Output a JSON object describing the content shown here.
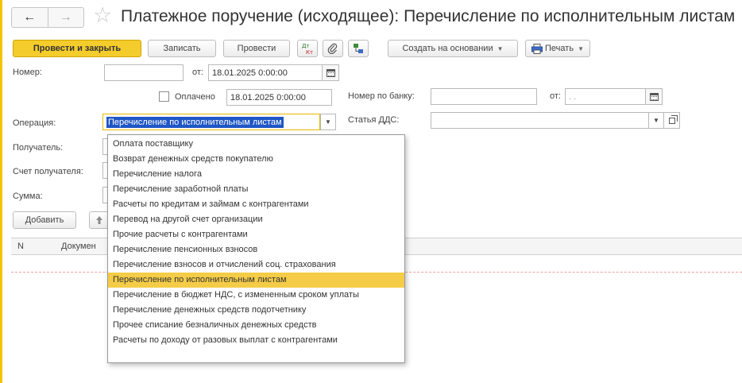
{
  "window": {
    "title": "Платежное поручение (исходящее): Перечисление по исполнительным листам"
  },
  "toolbar": {
    "post_and_close": "Провести и закрыть",
    "save": "Записать",
    "post": "Провести",
    "create_based_on": "Создать на основании",
    "print": "Печать"
  },
  "form": {
    "number_label": "Номер:",
    "number_value": "",
    "date_from_label": "от:",
    "date_value": "18.01.2025  0:00:00",
    "paid_label": "Оплачено",
    "paid_date_value": "18.01.2025  0:00:00",
    "bank_number_label": "Номер по банку:",
    "bank_number_value": "",
    "bank_date_label": "от:",
    "bank_date_value": "  .  .",
    "operation_label": "Операция:",
    "operation_value": "Перечисление по исполнительным листам",
    "dds_label": "Статья ДДС:",
    "dds_value": "",
    "recipient_label": "Получатель:",
    "recipient_account_label": "Счет получателя:",
    "sum_label": "Сумма:"
  },
  "table": {
    "add_button": "Добавить",
    "col_n": "N",
    "col_document": "Докумен"
  },
  "dropdown": {
    "selected_index": 9,
    "items": [
      "Оплата поставщику",
      "Возврат денежных средств покупателю",
      "Перечисление налога",
      "Перечисление заработной платы",
      "Расчеты по кредитам и займам с контрагентами",
      "Перевод на другой счет организации",
      "Прочие расчеты с контрагентами",
      "Перечисление пенсионных взносов",
      "Перечисление взносов и отчислений соц. страхования",
      "Перечисление по исполнительным листам",
      "Перечисление в бюджет НДС, с измененным сроком уплаты",
      "Перечисление денежных средств подотчетнику",
      "Прочее списание безналичных денежных средств",
      "Расчеты по доходу от разовых выплат с контрагентами"
    ]
  },
  "colors": {
    "accent": "#f4cc2b",
    "selection": "#f4cc47",
    "highlight_text_bg": "#1f57c5"
  }
}
